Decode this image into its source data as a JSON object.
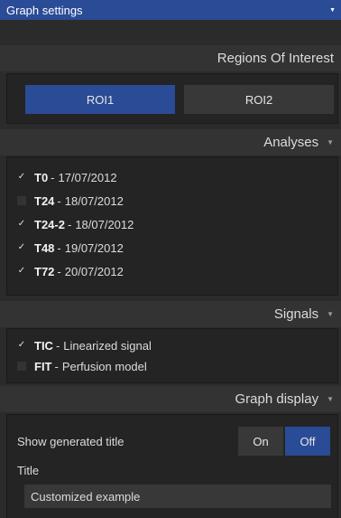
{
  "header": {
    "title": "Graph settings",
    "caret_icon": "caret-down-icon"
  },
  "roi": {
    "title": "Regions Of Interest",
    "buttons": [
      {
        "label": "ROI1",
        "active": true
      },
      {
        "label": "ROI2",
        "active": false
      }
    ]
  },
  "analyses": {
    "title": "Analyses",
    "items": [
      {
        "name": "T0",
        "date": "17/07/2012",
        "checked": true
      },
      {
        "name": "T24",
        "date": "18/07/2012",
        "checked": false
      },
      {
        "name": "T24-2",
        "date": "18/07/2012",
        "checked": true
      },
      {
        "name": "T48",
        "date": "19/07/2012",
        "checked": true
      },
      {
        "name": "T72",
        "date": "20/07/2012",
        "checked": true
      }
    ]
  },
  "signals": {
    "title": "Signals",
    "items": [
      {
        "name": "TIC",
        "desc": "Linearized signal",
        "checked": true
      },
      {
        "name": "FIT",
        "desc": "Perfusion model",
        "checked": false
      }
    ]
  },
  "graph_display": {
    "title": "Graph display",
    "show_title_label": "Show generated title",
    "toggle_on": "On",
    "toggle_off": "Off",
    "selected": "Off",
    "title_label": "Title",
    "title_value": "Customized example"
  },
  "colors": {
    "accent": "#2a4b96",
    "panel": "#242424",
    "header": "#333333"
  }
}
